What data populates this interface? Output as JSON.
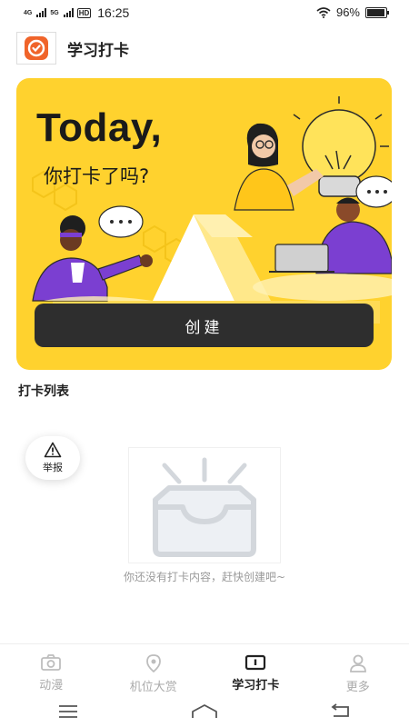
{
  "status_bar": {
    "net1": "4G",
    "net2": "5G",
    "hd": "HD",
    "time": "16:25",
    "battery_text": "96%",
    "battery_level": 0.96
  },
  "header": {
    "title": "学习打卡",
    "logo_icon": "clock-logo-icon"
  },
  "banner": {
    "title": "Today,",
    "subtitle": "你打卡了吗?",
    "button_label": "创建",
    "accent": "#FFD22E"
  },
  "list": {
    "title": "打卡列表",
    "empty_text": "你还没有打卡内容，赶快创建吧~"
  },
  "report": {
    "label": "举报",
    "icon": "warning-icon"
  },
  "tabs": [
    {
      "label": "动漫",
      "icon": "camera-icon",
      "active": false
    },
    {
      "label": "机位大赏",
      "icon": "location-pin-icon",
      "active": false
    },
    {
      "label": "学习打卡",
      "icon": "alert-box-icon",
      "active": true
    },
    {
      "label": "更多",
      "icon": "user-icon",
      "active": false
    }
  ],
  "nav": [
    "menu-icon",
    "home-icon",
    "back-icon"
  ]
}
